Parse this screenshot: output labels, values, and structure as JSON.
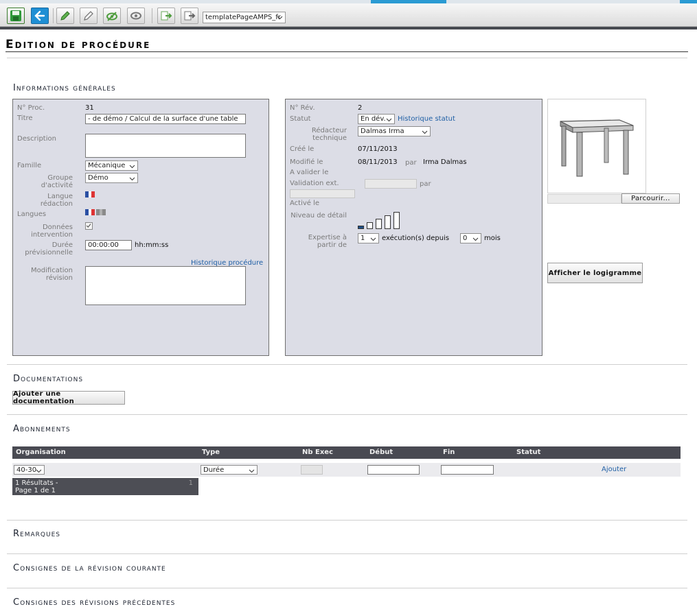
{
  "toolbar": {
    "template_select": "templatePageAMPS_fr",
    "icons": [
      "save-icon",
      "back-arrow-icon",
      "validate-pencil-icon",
      "edit-pencil-icon",
      "visible-eye-icon",
      "preview-eye-icon",
      "export-icon",
      "import-icon"
    ]
  },
  "page": {
    "title": "Edition de procédure"
  },
  "general": {
    "section_title": "Informations générales",
    "left": {
      "proc_label": "N° Proc.",
      "proc_value": "31",
      "titre_label": "Titre",
      "titre_value": "- de démo / Calcul de la surface d'une table",
      "description_label": "Description",
      "famille_label": "Famille",
      "famille_value": "Mécanique",
      "groupe_label": "Groupe d'activité",
      "groupe_value": "Démo",
      "langue_redaction_label": "Langue rédaction",
      "langues_label": "Langues",
      "donnees_label": "Données intervention",
      "duree_label": "Durée prévisionnelle",
      "duree_value": "00:00:00",
      "duree_unit": "hh:mm:ss",
      "historique_link": "Historique procédure",
      "modification_label": "Modification révision"
    },
    "right": {
      "rev_label": "N° Rév.",
      "rev_value": "2",
      "statut_label": "Statut",
      "statut_value": "En dév.",
      "historique_statut_link": "Historique statut",
      "redacteur_label": "Rédacteur technique",
      "redacteur_value": "Dalmas Irma",
      "cree_label": "Créé le",
      "cree_value": "07/11/2013",
      "modifie_label": "Modifié le",
      "modifie_value": "08/11/2013",
      "par_label": "par",
      "modifie_par": "Irma Dalmas",
      "avalider_label": "A valider le",
      "validation_label": "Validation ext.",
      "validation_par": "par",
      "active_label": "Activé le",
      "niveau_label": "Niveau de détail",
      "niveau_level": 1,
      "niveau_max": 5,
      "expertise_label": "Expertise à partir de",
      "expertise_value": "1",
      "executions_label": "exécution(s) depuis",
      "mois_value": "0",
      "mois_label": "mois"
    },
    "image": {
      "browse_button": "Parcourir...",
      "logigramme_button": "Afficher le logigramme"
    }
  },
  "documentations": {
    "section_title": "Documentations",
    "add_button": "Ajouter une documentation"
  },
  "abonnements": {
    "section_title": "Abonnements",
    "columns": [
      "Organisation",
      "Type",
      "Nb Exec",
      "Début",
      "Fin",
      "Statut"
    ],
    "row": {
      "organisation": "40-30",
      "type": "Durée",
      "nb_exec": "",
      "debut": "",
      "fin": "",
      "ajouter": "Ajouter"
    },
    "results_line1": "1 Résultats -",
    "results_line2": "Page 1 de 1",
    "results_page": "1"
  },
  "sections": {
    "remarques": "Remarques",
    "consignes_courante": "Consignes de la révision courante",
    "consignes_precedentes": "Consignes des révisions précédentes"
  },
  "colors": {
    "panel": "#dcdde6",
    "header_dark": "#494a52",
    "link": "#1f5fa5",
    "accent": "#2b9bd3"
  }
}
